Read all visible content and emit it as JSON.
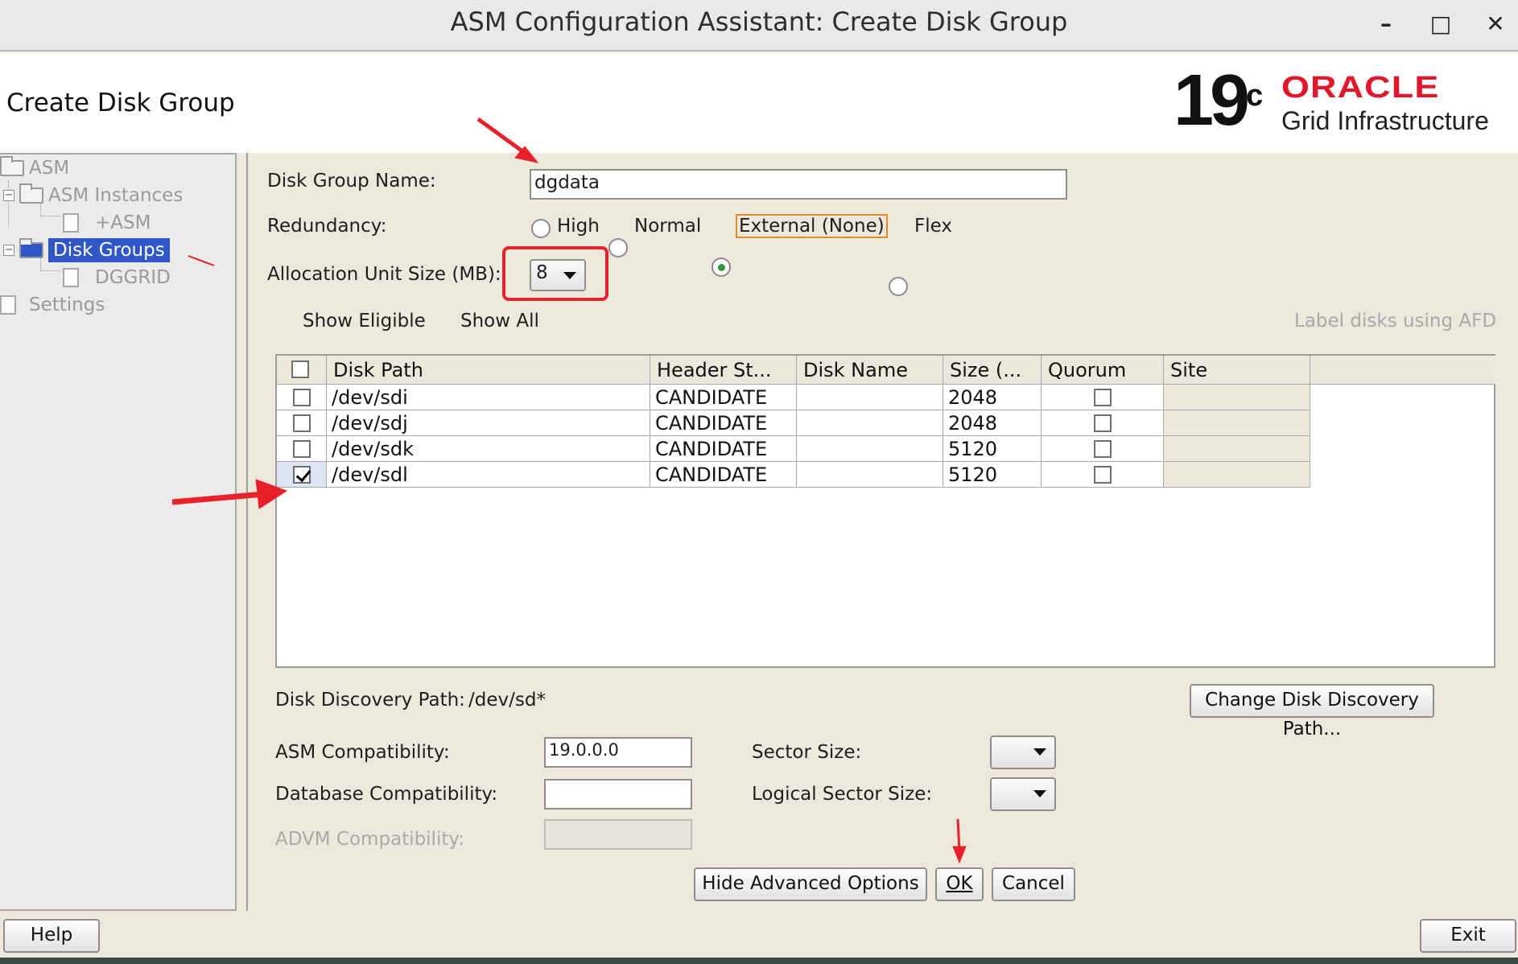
{
  "window": {
    "title": "ASM Configuration Assistant: Create Disk Group",
    "controls": [
      "–",
      "□",
      "✕"
    ]
  },
  "header": {
    "page_title": "Create Disk Group",
    "logo_version": "19",
    "logo_version_sup": "c",
    "logo_brand": "ORACLE",
    "logo_product": "Grid Infrastructure"
  },
  "nav": {
    "items": [
      {
        "label": "ASM"
      },
      {
        "label": "ASM Instances"
      },
      {
        "label": "+ASM"
      },
      {
        "label": "Disk Groups"
      },
      {
        "label": "DGGRID"
      },
      {
        "label": "Settings"
      }
    ],
    "selected": "Disk Groups"
  },
  "form": {
    "disk_group_name_label": "Disk Group Name:",
    "disk_group_name_value": "dgdata",
    "redundancy_label": "Redundancy:",
    "redundancy_options": [
      "High",
      "Normal",
      "External (None)",
      "Flex"
    ],
    "redundancy_selected": "External (None)",
    "au_size_label": "Allocation Unit Size (MB):",
    "au_size_value": "8",
    "show_eligible_label": "Show Eligible",
    "show_all_label": "Show All",
    "show_selected": "Show Eligible",
    "label_afd_label": "Label disks using AFD",
    "label_afd_checked": false
  },
  "table": {
    "columns": [
      "Disk Path",
      "Header St...",
      "Disk Name",
      "Size (...",
      "Quorum",
      "Site"
    ],
    "rows": [
      {
        "selected": false,
        "path": "/dev/sdi",
        "header": "CANDIDATE",
        "name": "",
        "size": "2048",
        "quorum": false,
        "site": ""
      },
      {
        "selected": false,
        "path": "/dev/sdj",
        "header": "CANDIDATE",
        "name": "",
        "size": "2048",
        "quorum": false,
        "site": ""
      },
      {
        "selected": false,
        "path": "/dev/sdk",
        "header": "CANDIDATE",
        "name": "",
        "size": "5120",
        "quorum": false,
        "site": ""
      },
      {
        "selected": true,
        "path": "/dev/sdl",
        "header": "CANDIDATE",
        "name": "",
        "size": "5120",
        "quorum": false,
        "site": ""
      }
    ]
  },
  "discovery": {
    "label": "Disk Discovery Path:",
    "value": "/dev/sd*",
    "change_button": "Change Disk Discovery Path..."
  },
  "advanced": {
    "asm_compat_label": "ASM Compatibility:",
    "asm_compat_value": "19.0.0.0",
    "db_compat_label": "Database Compatibility:",
    "db_compat_value": "",
    "advm_compat_label": "ADVM Compatibility:",
    "advm_compat_value": "",
    "sector_size_label": "Sector Size:",
    "sector_size_value": "",
    "logical_sector_size_label": "Logical Sector Size:",
    "logical_sector_size_value": ""
  },
  "buttons": {
    "hide_advanced": "Hide Advanced Options",
    "ok": "OK",
    "cancel": "Cancel",
    "help": "Help",
    "exit": "Exit"
  },
  "colors": {
    "annotation": "#e8202a",
    "selection": "#2f57c8",
    "oracle_red": "#e3162a"
  }
}
